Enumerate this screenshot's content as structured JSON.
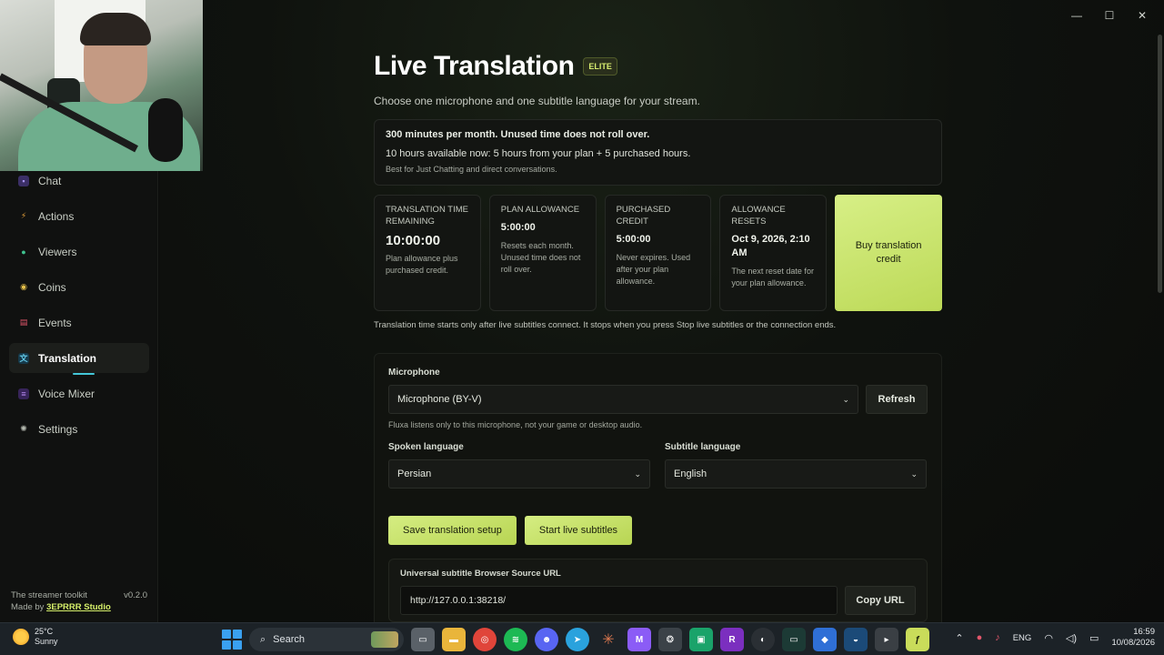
{
  "window": {
    "minimize": "—",
    "maximize": "☐",
    "close": "✕"
  },
  "sidebar": {
    "items": [
      {
        "label": "Chat",
        "icon": "chat-icon",
        "color": "#8a6fe0"
      },
      {
        "label": "Actions",
        "icon": "bolt-icon",
        "color": "#e7a23b"
      },
      {
        "label": "Viewers",
        "icon": "users-icon",
        "color": "#3fc28f"
      },
      {
        "label": "Coins",
        "icon": "coin-icon",
        "color": "#e5c04a"
      },
      {
        "label": "Events",
        "icon": "calendar-icon",
        "color": "#e2566b"
      },
      {
        "label": "Translation",
        "icon": "translate-icon",
        "color": "#46b8d8",
        "active": true
      },
      {
        "label": "Voice Mixer",
        "icon": "mixer-icon",
        "color": "#a36de0"
      },
      {
        "label": "Settings",
        "icon": "gear-icon",
        "color": "#b7bcb2"
      }
    ],
    "footer": {
      "tagline": "The streamer toolkit",
      "version": "v0.2.0",
      "made_by": "Made by",
      "studio": "3EPRRR Studio"
    }
  },
  "page": {
    "title": "Live Translation",
    "badge": "ELITE",
    "subtitle": "Choose one microphone and one subtitle language for your stream."
  },
  "info": {
    "line1": "300 minutes per month. Unused time does not roll over.",
    "line2": "10 hours available now: 5 hours from your plan + 5 purchased hours.",
    "line3": "Best for Just Chatting and direct conversations."
  },
  "cards": [
    {
      "label": "Translation time remaining",
      "value": "10:00:00",
      "note": "Plan allowance plus purchased credit."
    },
    {
      "label": "Plan allowance",
      "value": "5:00:00",
      "note": "Resets each month. Unused time does not roll over."
    },
    {
      "label": "Purchased credit",
      "value": "5:00:00",
      "note": "Never expires. Used after your plan allowance."
    },
    {
      "label": "Allowance resets",
      "value": "Oct 9, 2026, 2:10 AM",
      "note": "The next reset date for your plan allowance."
    }
  ],
  "buy_button": "Buy translation credit",
  "time_note": "Translation time starts only after live subtitles connect. It stops when you press Stop live subtitles or the connection ends.",
  "setup": {
    "microphone_label": "Microphone",
    "microphone_value": "Microphone (BY-V)",
    "refresh": "Refresh",
    "mic_hint": "Fluxa listens only to this microphone, not your game or desktop audio.",
    "spoken_label": "Spoken language",
    "spoken_value": "Persian",
    "subtitle_label": "Subtitle language",
    "subtitle_value": "English",
    "save_button": "Save translation setup",
    "start_button": "Start live subtitles",
    "url_label": "Universal subtitle Browser Source URL",
    "url_value": "http://127.0.0.1:38218/",
    "copy_button": "Copy URL"
  },
  "taskbar": {
    "weather_temp": "25°C",
    "weather_desc": "Sunny",
    "search": "Search",
    "lang": "ENG",
    "time": "16:59",
    "date": "10/08/2026",
    "apps": [
      {
        "icon": "files-icon",
        "color": "#5a6168"
      },
      {
        "icon": "folder-icon",
        "color": "#e9b53b"
      },
      {
        "icon": "chrome-icon",
        "color": "#e0453a"
      },
      {
        "icon": "spotify-icon",
        "color": "#1db954"
      },
      {
        "icon": "discord-icon",
        "color": "#5865f2"
      },
      {
        "icon": "telegram-icon",
        "color": "#2aa2dd"
      },
      {
        "icon": "claude-icon",
        "color": "#d9774f"
      },
      {
        "icon": "gmail-icon",
        "color": "#8b5cf6"
      },
      {
        "icon": "openai-icon",
        "color": "#3b4248"
      },
      {
        "icon": "app-green-icon",
        "color": "#1aa36a"
      },
      {
        "icon": "r-icon",
        "color": "#7b2fbf"
      },
      {
        "icon": "obs-icon",
        "color": "#2a2f34"
      },
      {
        "icon": "terminal-icon",
        "color": "#1c3a35"
      },
      {
        "icon": "vpn-icon",
        "color": "#2f6fd6"
      },
      {
        "icon": "steam-icon",
        "color": "#1b4a78"
      },
      {
        "icon": "console-icon",
        "color": "#3a3f44"
      },
      {
        "icon": "fluxa-icon",
        "color": "#c9dc5a"
      }
    ]
  }
}
